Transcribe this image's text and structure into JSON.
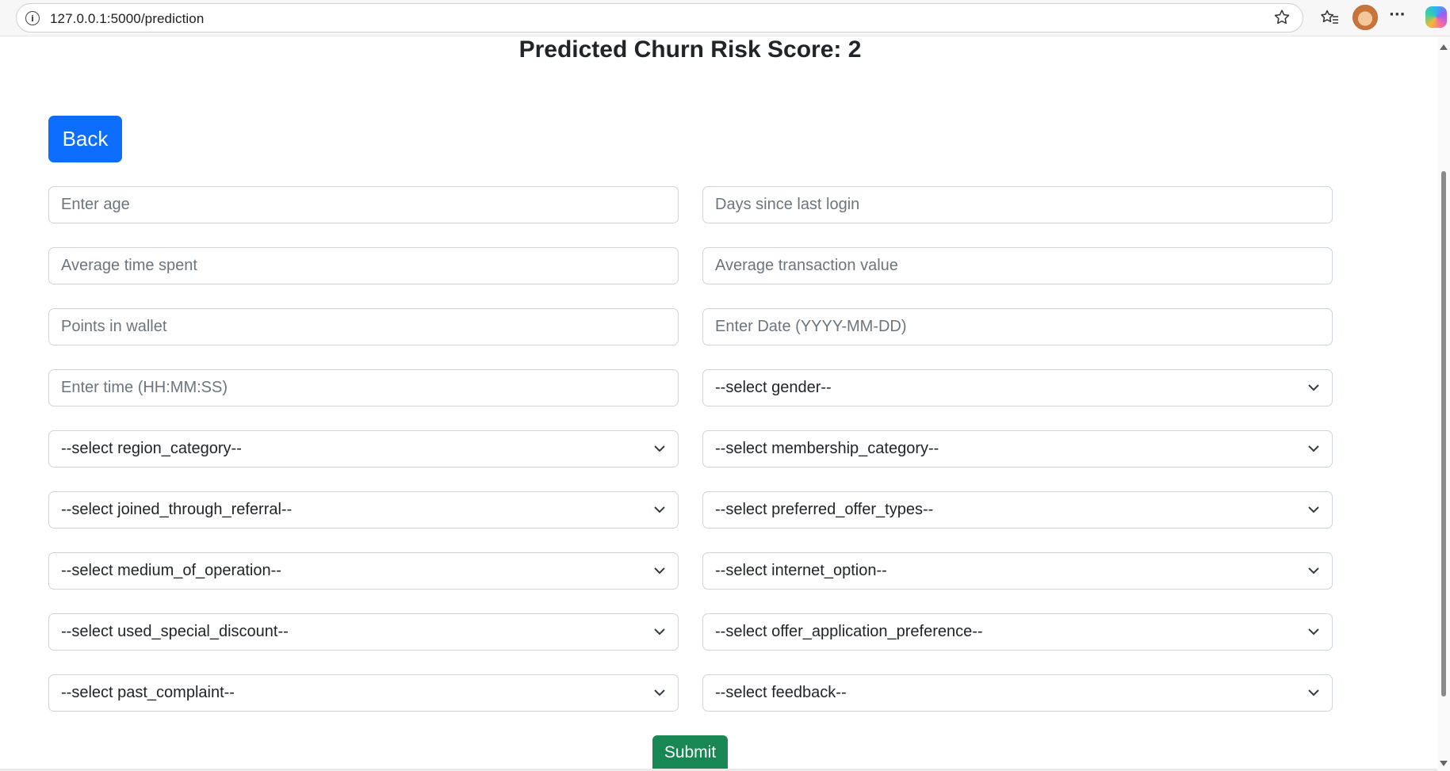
{
  "browser": {
    "url": "127.0.0.1:5000/prediction",
    "icons": [
      "info-icon",
      "star-icon",
      "favorites-icon",
      "profile-avatar",
      "more-icon",
      "copilot-icon"
    ]
  },
  "page": {
    "title": "Predicted Churn Risk Score: 2",
    "back_label": "Back",
    "submit_label": "Submit"
  },
  "fields": {
    "age": "Enter age",
    "days_since_last_login": "Days since last login",
    "avg_time_spent": "Average time spent",
    "avg_transaction_value": "Average transaction value",
    "points_in_wallet": "Points in wallet",
    "date": "Enter Date (YYYY-MM-DD)",
    "time": "Enter time (HH:MM:SS)"
  },
  "selects": {
    "gender": "--select gender--",
    "region_category": "--select region_category--",
    "membership_category": "--select membership_category--",
    "joined_through_referral": "--select joined_through_referral--",
    "preferred_offer_types": "--select preferred_offer_types--",
    "medium_of_operation": "--select medium_of_operation--",
    "internet_option": "--select internet_option--",
    "used_special_discount": "--select used_special_discount--",
    "offer_application_preference": "--select offer_application_preference--",
    "past_complaint": "--select past_complaint--",
    "feedback": "--select feedback--"
  },
  "colors": {
    "primary": "#0d6efd",
    "success": "#198754",
    "border": "#ced4da",
    "placeholder": "#6c757d"
  }
}
